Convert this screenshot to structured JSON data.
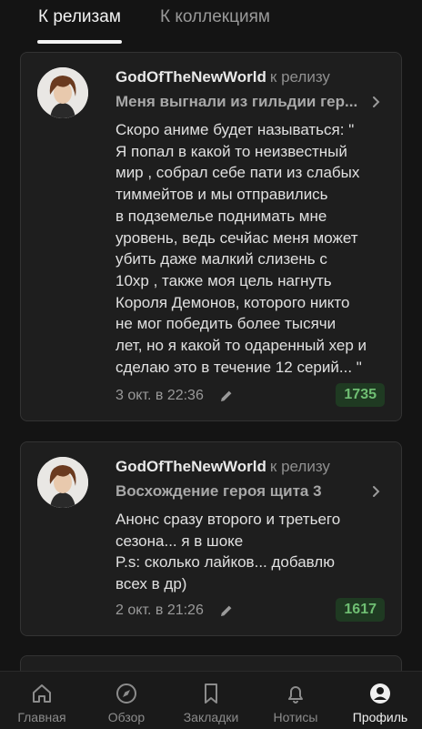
{
  "tabs": [
    {
      "label": "К релизам",
      "active": true
    },
    {
      "label": "К коллекциям",
      "active": false
    }
  ],
  "comments": [
    {
      "author": "GodOfTheNewWorld",
      "to_release_label": "к релизу",
      "release_title": "Меня выгнали из гильдии гер...",
      "text": "Скоро аниме будет называться: \"\nЯ попал в какой то неизвестный\nмир , собрал себе пати из слабых\nтиммейтов и мы отправились\nв подземелье поднимать мне\nуровень, ведь сечйас меня может\nубить даже малкий слизень с\n10хр , также моя цель нагнуть\nКороля Демонов, которого никто\nне мог победить более тысячи\nлет, но я какой то одаренный хер и\nсделаю это в течение 12 серий... \"",
      "date": "3 окт. в 22:36",
      "likes": "1735"
    },
    {
      "author": "GodOfTheNewWorld",
      "to_release_label": "к релизу",
      "release_title": "Восхождение героя щита 3",
      "text": "Анонс сразу второго и третьего\nсезона... я в шоке\nP.s: сколько лайков... добавлю\nвсех в др)",
      "date": "2 окт. в 21:26",
      "likes": "1617"
    }
  ],
  "bottom_nav": [
    {
      "label": "Главная",
      "icon": "home-icon"
    },
    {
      "label": "Обзор",
      "icon": "compass-icon"
    },
    {
      "label": "Закладки",
      "icon": "bookmark-icon"
    },
    {
      "label": "Нотисы",
      "icon": "bell-icon"
    },
    {
      "label": "Профиль",
      "icon": "profile-icon",
      "active": true
    }
  ],
  "colors": {
    "background": "#141414",
    "card": "#1e1e1e",
    "likes_bg": "#1f3a22",
    "likes_text": "#6fbf73"
  }
}
